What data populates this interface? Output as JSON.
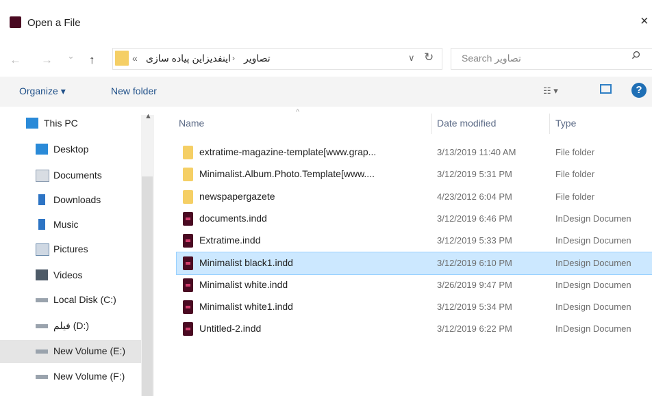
{
  "window": {
    "title": "Open a File",
    "close": "×"
  },
  "address": {
    "nav_back": "←",
    "nav_forward": "→",
    "nav_dropdown": "⌄",
    "nav_up": "↑",
    "overflow": "«",
    "crumbs": [
      "اینفدیزاین پیاده سازی",
      "تصاویر"
    ],
    "crumb_arrow": "›",
    "dropdown": "∨",
    "refresh": "↻"
  },
  "search": {
    "placeholder": "Search تصاویر"
  },
  "commandbar": {
    "organize": "Organize ▾",
    "new_folder": "New folder",
    "views": "☷ ▾",
    "help": "?"
  },
  "sidebar": {
    "items": [
      {
        "label": "This PC",
        "icon": "computer-icon"
      },
      {
        "label": "Desktop",
        "icon": "desktop-icon"
      },
      {
        "label": "Documents",
        "icon": "documents-icon"
      },
      {
        "label": "Downloads",
        "icon": "downloads-icon"
      },
      {
        "label": "Music",
        "icon": "music-icon"
      },
      {
        "label": "Pictures",
        "icon": "pictures-icon"
      },
      {
        "label": "Videos",
        "icon": "videos-icon"
      },
      {
        "label": "Local Disk (C:)",
        "icon": "drive-icon"
      },
      {
        "label": "فیلم (D:)",
        "icon": "drive-icon"
      },
      {
        "label": "New Volume (E:)",
        "icon": "drive-icon",
        "selected": true
      },
      {
        "label": "New Volume (F:)",
        "icon": "drive-icon"
      }
    ]
  },
  "columns": {
    "name": "Name",
    "date": "Date modified",
    "type": "Type",
    "sort_caret": "^"
  },
  "files": [
    {
      "name": "extratime-magazine-template[www.grap...",
      "date": "3/13/2019 11:40 AM",
      "type": "File folder",
      "kind": "folder"
    },
    {
      "name": "Minimalist.Album.Photo.Template[www....",
      "date": "3/12/2019 5:31 PM",
      "type": "File folder",
      "kind": "folder"
    },
    {
      "name": "newspapergazete",
      "date": "4/23/2012 6:04 PM",
      "type": "File folder",
      "kind": "folder"
    },
    {
      "name": "documents.indd",
      "date": "3/12/2019 6:46 PM",
      "type": "InDesign Documen",
      "kind": "indd"
    },
    {
      "name": "Extratime.indd",
      "date": "3/12/2019 5:33 PM",
      "type": "InDesign Documen",
      "kind": "indd"
    },
    {
      "name": "Minimalist black1.indd",
      "date": "3/12/2019 6:10 PM",
      "type": "InDesign Documen",
      "kind": "indd",
      "selected": true
    },
    {
      "name": "Minimalist white.indd",
      "date": "3/26/2019 9:47 PM",
      "type": "InDesign Documen",
      "kind": "indd"
    },
    {
      "name": "Minimalist white1.indd",
      "date": "3/12/2019 5:34 PM",
      "type": "InDesign Documen",
      "kind": "indd"
    },
    {
      "name": "Untitled-2.indd",
      "date": "3/12/2019 6:22 PM",
      "type": "InDesign Documen",
      "kind": "indd"
    }
  ],
  "colors": {
    "accent": "#1f6fb5",
    "selection": "#cce8ff",
    "folder": "#f5cf65",
    "indd": "#4a0a22"
  }
}
